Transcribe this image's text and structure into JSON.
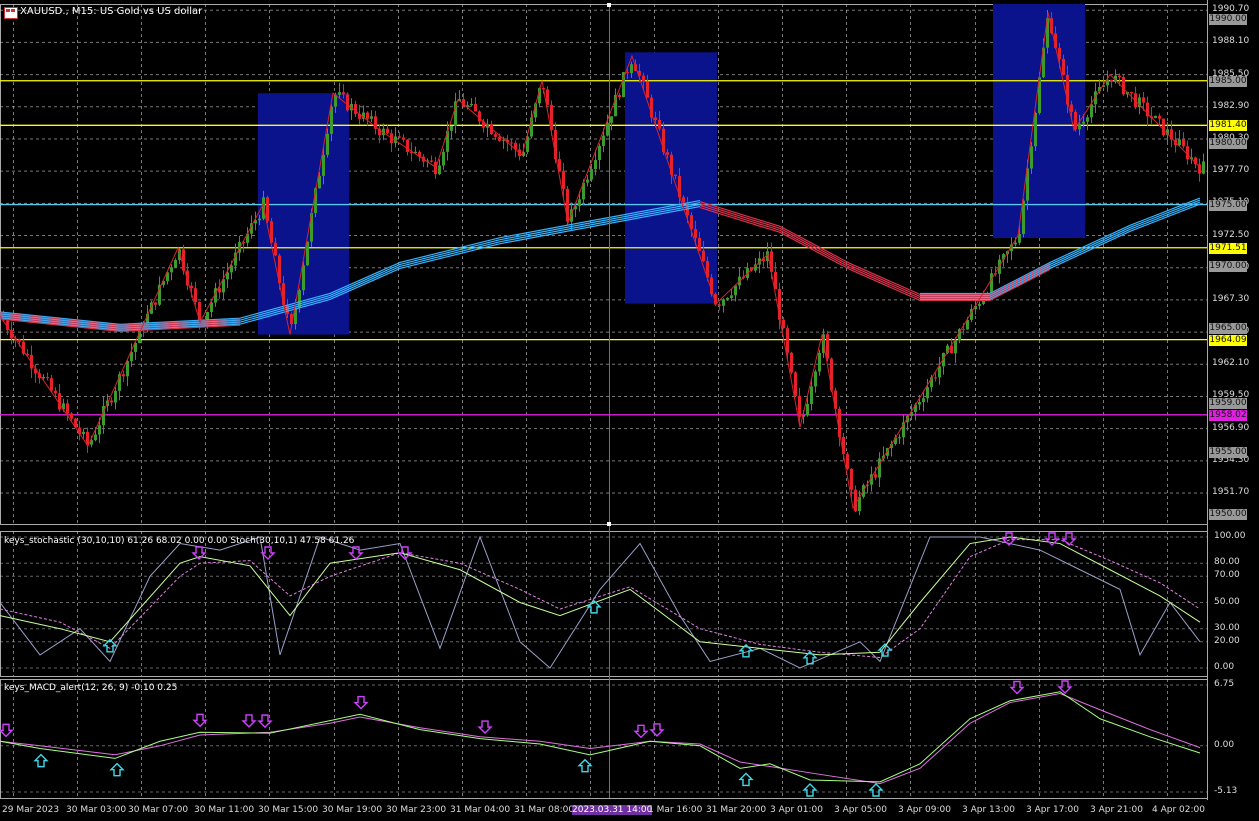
{
  "window": {
    "title": "XAUUSD., M15:  US Gold vs US dollar"
  },
  "indicators": {
    "stoch_label": "keys_stochastic (30,10,10) 61.26 68.02 0.00 0.00 Stoch(30,10,1) 47.58 61.26",
    "macd_label": "keys_MACD_alert(12, 26, 9) -0.10 0.25"
  },
  "colors": {
    "bull": "#3b9c2e",
    "bear": "#e8202a",
    "zigzag": "#d8242c",
    "ma_blue": "#35b4ff",
    "ma_red": "#d8324a",
    "zone": "#0a128c",
    "level_yellow": "#ffff00",
    "level_cyan": "#5ec8e8",
    "level_magenta": "#e020e0",
    "down_arrow": "#d040ff",
    "up_arrow": "#40d8e8",
    "grid": "#c8c8c8"
  },
  "chart_data": [
    {
      "type": "candlestick",
      "title": "XAUUSD., M15:  US Gold vs US dollar",
      "ylim": [
        1949.2,
        1991.2
      ],
      "price_ticks": [
        "1990.70",
        "1988.10",
        "1985.50",
        "1982.90",
        "1980.30",
        "1977.70",
        "1975.10",
        "1972.50",
        "1969.90",
        "1967.30",
        "1964.70",
        "1962.10",
        "1959.50",
        "1956.90",
        "1954.30",
        "1951.70"
      ],
      "time_labels": [
        "29 Mar 2023",
        "30 Mar 03:00",
        "30 Mar 07:00",
        "30 Mar 11:00",
        "30 Mar 15:00",
        "30 Mar 19:00",
        "30 Mar 23:00",
        "31 Mar 04:00",
        "31 Mar 08:00",
        "2023.03.31 14:00",
        "1 Mar 16:00",
        "31 Mar 20:00",
        "3 Apr 01:00",
        "3 Apr 05:00",
        "3 Apr 09:00",
        "3 Apr 13:00",
        "3 Apr 17:00",
        "3 Apr 21:00",
        "4 Apr 02:00"
      ],
      "zigzag": [
        [
          0,
          1966.0
        ],
        [
          88,
          1955.5
        ],
        [
          178,
          1971.5
        ],
        [
          200,
          1965.5
        ],
        [
          263,
          1975.0
        ],
        [
          290,
          1964.5
        ],
        [
          333,
          1984.0
        ],
        [
          380,
          1981.0
        ],
        [
          436,
          1978.0
        ],
        [
          458,
          1983.5
        ],
        [
          522,
          1979.0
        ],
        [
          542,
          1985.0
        ],
        [
          568,
          1973.5
        ],
        [
          632,
          1987.0
        ],
        [
          716,
          1967.0
        ],
        [
          768,
          1971.0
        ],
        [
          800,
          1957.0
        ],
        [
          822,
          1964.5
        ],
        [
          853,
          1950.5
        ],
        [
          1018,
          1972.5
        ],
        [
          1048,
          1990.5
        ],
        [
          1074,
          1981.0
        ],
        [
          1110,
          1985.5
        ],
        [
          1200,
          1978.0
        ]
      ],
      "ma_blue": [
        [
          0,
          1966.0
        ],
        [
          120,
          1965.0
        ],
        [
          240,
          1965.5
        ],
        [
          330,
          1967.5
        ],
        [
          400,
          1970.0
        ],
        [
          500,
          1972.0
        ],
        [
          600,
          1973.5
        ],
        [
          700,
          1975.0
        ],
        [
          780,
          1973.0
        ],
        [
          850,
          1970.0
        ],
        [
          920,
          1967.5
        ],
        [
          990,
          1967.5
        ],
        [
          1050,
          1970.0
        ],
        [
          1130,
          1973.0
        ],
        [
          1200,
          1975.2
        ]
      ],
      "ma_red": [
        [
          0,
          1966.0
        ],
        [
          120,
          1965.0
        ],
        [
          240,
          1965.5
        ],
        [
          330,
          1967.5
        ],
        [
          400,
          1970.0
        ],
        [
          500,
          1972.0
        ],
        [
          600,
          1973.5
        ],
        [
          700,
          1975.0
        ],
        [
          780,
          1973.0
        ],
        [
          850,
          1970.0
        ],
        [
          920,
          1967.5
        ],
        [
          990,
          1967.5
        ],
        [
          1050,
          1970.0
        ],
        [
          1130,
          1973.0
        ],
        [
          1200,
          1975.2
        ]
      ],
      "zones": [
        {
          "x1": 258,
          "x2": 349,
          "top": 1984.0,
          "bottom": 1964.5
        },
        {
          "x1": 625,
          "x2": 717,
          "top": 1987.3,
          "bottom": 1967.0
        },
        {
          "x1": 993,
          "x2": 1085,
          "top": 1991.2,
          "bottom": 1972.3
        }
      ],
      "levels": [
        {
          "price": "1985.00",
          "value": 1985.0,
          "color": "#ffff00",
          "tag": "grey"
        },
        {
          "price": "1981.40",
          "value": 1981.4,
          "color": "#ffff00",
          "tag": "yellow"
        },
        {
          "price": "1975.00",
          "value": 1975.0,
          "color": "#5ec8e8",
          "tag": "grey"
        },
        {
          "price": "1971.51",
          "value": 1971.51,
          "color": "#ffff00",
          "tag": "yellow"
        },
        {
          "price": "1964.09",
          "value": 1964.09,
          "color": "#ffff00",
          "tag": "yellow"
        },
        {
          "price": "1958.02",
          "value": 1958.02,
          "color": "#e020e0",
          "tag": "magenta"
        }
      ],
      "grey_price_tags": [
        "1990.00",
        "1980.00",
        "1970.00",
        "1965.00",
        "1959.00",
        "1955.00",
        "1950.00"
      ]
    },
    {
      "type": "line",
      "title": "keys_stochastic (30,10,10) 61.26 68.02 0.00 0.00 Stoch(30,10,1) 47.58 61.26",
      "ylim": [
        0,
        100
      ],
      "y_ticks": [
        "100.00",
        "80.00",
        "70.00",
        "50.00",
        "30.00",
        "20.00",
        "0.00"
      ],
      "main": [
        [
          0,
          40
        ],
        [
          60,
          30
        ],
        [
          110,
          20
        ],
        [
          180,
          80
        ],
        [
          200,
          85
        ],
        [
          250,
          78
        ],
        [
          290,
          40
        ],
        [
          330,
          80
        ],
        [
          400,
          88
        ],
        [
          460,
          75
        ],
        [
          520,
          50
        ],
        [
          560,
          40
        ],
        [
          630,
          60
        ],
        [
          700,
          20
        ],
        [
          760,
          15
        ],
        [
          820,
          10
        ],
        [
          880,
          12
        ],
        [
          920,
          50
        ],
        [
          970,
          95
        ],
        [
          1010,
          100
        ],
        [
          1060,
          95
        ],
        [
          1110,
          75
        ],
        [
          1160,
          55
        ],
        [
          1200,
          35
        ]
      ],
      "signal": [
        [
          0,
          45
        ],
        [
          60,
          35
        ],
        [
          110,
          15
        ],
        [
          180,
          70
        ],
        [
          200,
          80
        ],
        [
          250,
          82
        ],
        [
          290,
          55
        ],
        [
          330,
          70
        ],
        [
          400,
          88
        ],
        [
          460,
          80
        ],
        [
          520,
          60
        ],
        [
          560,
          45
        ],
        [
          630,
          62
        ],
        [
          700,
          30
        ],
        [
          760,
          18
        ],
        [
          820,
          12
        ],
        [
          880,
          8
        ],
        [
          920,
          30
        ],
        [
          970,
          85
        ],
        [
          1010,
          98
        ],
        [
          1060,
          98
        ],
        [
          1110,
          82
        ],
        [
          1160,
          65
        ],
        [
          1200,
          45
        ]
      ],
      "raw": [
        [
          0,
          50
        ],
        [
          40,
          10
        ],
        [
          80,
          30
        ],
        [
          110,
          5
        ],
        [
          150,
          70
        ],
        [
          180,
          95
        ],
        [
          220,
          90
        ],
        [
          260,
          100
        ],
        [
          280,
          10
        ],
        [
          320,
          100
        ],
        [
          360,
          90
        ],
        [
          400,
          95
        ],
        [
          440,
          15
        ],
        [
          480,
          100
        ],
        [
          520,
          20
        ],
        [
          550,
          0
        ],
        [
          600,
          60
        ],
        [
          640,
          95
        ],
        [
          680,
          40
        ],
        [
          710,
          5
        ],
        [
          760,
          15
        ],
        [
          800,
          0
        ],
        [
          860,
          20
        ],
        [
          880,
          5
        ],
        [
          930,
          100
        ],
        [
          980,
          100
        ],
        [
          1040,
          90
        ],
        [
          1080,
          75
        ],
        [
          1120,
          60
        ],
        [
          1140,
          10
        ],
        [
          1170,
          50
        ],
        [
          1200,
          20
        ]
      ],
      "down_arrows_x": [
        199,
        268,
        356,
        405
      ],
      "down_arrows_x2": [
        1009,
        1052,
        1069
      ],
      "up_arrows_x": [
        110,
        594,
        746,
        810,
        885
      ]
    },
    {
      "type": "line",
      "title": "keys_MACD_alert(12, 26, 9) -0.10 0.25",
      "ylim": [
        -5.13,
        6.75
      ],
      "y_ticks": [
        "6.75",
        "0.00",
        "-5.13"
      ],
      "macd": [
        [
          0,
          0.5
        ],
        [
          40,
          -0.3
        ],
        [
          115,
          -1.4
        ],
        [
          160,
          0.5
        ],
        [
          200,
          1.5
        ],
        [
          270,
          1.4
        ],
        [
          330,
          2.8
        ],
        [
          360,
          3.5
        ],
        [
          420,
          1.8
        ],
        [
          480,
          0.8
        ],
        [
          540,
          0.2
        ],
        [
          590,
          -1.0
        ],
        [
          650,
          0.5
        ],
        [
          700,
          0.0
        ],
        [
          740,
          -2.5
        ],
        [
          770,
          -2.0
        ],
        [
          810,
          -3.8
        ],
        [
          880,
          -4.0
        ],
        [
          920,
          -2.0
        ],
        [
          970,
          3.0
        ],
        [
          1010,
          5.0
        ],
        [
          1060,
          6.0
        ],
        [
          1100,
          3.0
        ],
        [
          1150,
          1.0
        ],
        [
          1200,
          -0.8
        ]
      ],
      "signal": [
        [
          0,
          0.5
        ],
        [
          40,
          0.0
        ],
        [
          115,
          -1.0
        ],
        [
          160,
          0.0
        ],
        [
          200,
          1.2
        ],
        [
          270,
          1.5
        ],
        [
          330,
          2.5
        ],
        [
          360,
          3.2
        ],
        [
          420,
          2.0
        ],
        [
          480,
          1.0
        ],
        [
          540,
          0.5
        ],
        [
          590,
          -0.3
        ],
        [
          650,
          0.5
        ],
        [
          700,
          0.2
        ],
        [
          740,
          -1.8
        ],
        [
          770,
          -2.3
        ],
        [
          810,
          -3.0
        ],
        [
          880,
          -4.2
        ],
        [
          920,
          -2.5
        ],
        [
          970,
          2.5
        ],
        [
          1010,
          4.8
        ],
        [
          1060,
          5.8
        ],
        [
          1100,
          4.0
        ],
        [
          1150,
          1.8
        ],
        [
          1200,
          -0.2
        ]
      ],
      "down_arrows_x": [
        6,
        200,
        249,
        265,
        361,
        485,
        641,
        657,
        1017,
        1065
      ],
      "up_arrows_x": [
        41,
        117,
        585,
        746,
        810,
        876
      ]
    }
  ]
}
